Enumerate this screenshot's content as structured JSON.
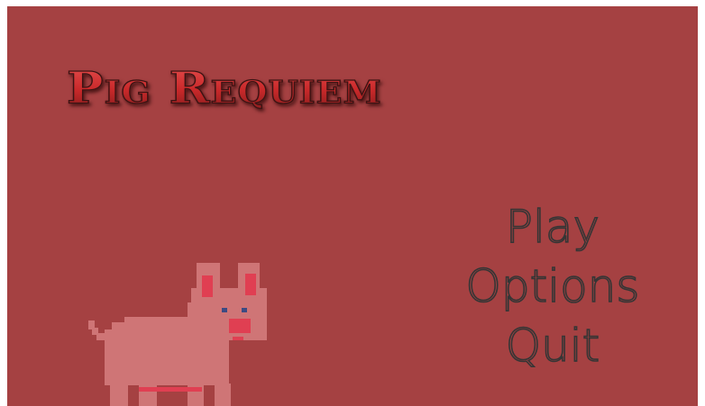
{
  "game": {
    "title": "Pig Requiem",
    "menu": [
      {
        "label": "Play"
      },
      {
        "label": "Options"
      },
      {
        "label": "Quit"
      }
    ]
  },
  "colors": {
    "background": "#a54142",
    "pig_body": "#cf7576",
    "pig_ear_inner": "#e03f52",
    "pig_snout": "#e03f52",
    "pig_eye": "#3d4a82",
    "menu_outline": "#353535"
  },
  "character": "pink-pixel-pig-icon"
}
